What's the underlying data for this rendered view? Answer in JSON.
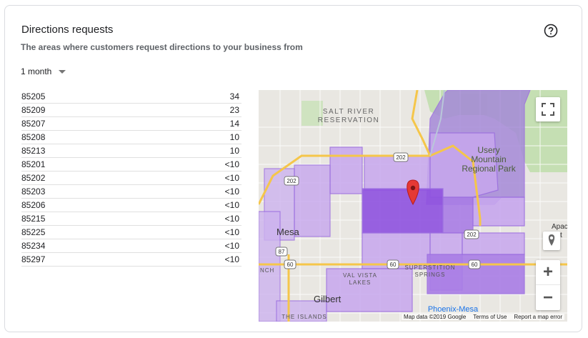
{
  "header": {
    "title": "Directions requests",
    "subtitle": "The areas where customers request directions to your business from"
  },
  "period": {
    "selected": "1 month"
  },
  "table": {
    "rows": [
      {
        "zip": "85205",
        "count": "34"
      },
      {
        "zip": "85209",
        "count": "23"
      },
      {
        "zip": "85207",
        "count": "14"
      },
      {
        "zip": "85208",
        "count": "10"
      },
      {
        "zip": "85213",
        "count": "10"
      },
      {
        "zip": "85201",
        "count": "<10"
      },
      {
        "zip": "85202",
        "count": "<10"
      },
      {
        "zip": "85203",
        "count": "<10"
      },
      {
        "zip": "85206",
        "count": "<10"
      },
      {
        "zip": "85215",
        "count": "<10"
      },
      {
        "zip": "85225",
        "count": "<10"
      },
      {
        "zip": "85234",
        "count": "<10"
      },
      {
        "zip": "85297",
        "count": "<10"
      }
    ]
  },
  "map": {
    "labels": {
      "reservation_1": "SALT RIVER",
      "reservation_2": "RESERVATION",
      "park_1": "Usery",
      "park_2": "Mountain",
      "park_3": "Regional Park",
      "mesa": "Mesa",
      "gilbert": "Gilbert",
      "superstition_1": "SUPERSTITION",
      "superstition_2": "SPRINGS",
      "valvista_1": "VAL VISTA",
      "valvista_2": "LAKES",
      "phoenix_mesa": "Phoenix-Mesa",
      "islands": "THE ISLANDS",
      "apache_1": "Apache",
      "apache_2": "Jct",
      "ranch": "NCH",
      "hwy_202_a": "202",
      "hwy_202_b": "202",
      "hwy_202_c": "202",
      "hwy_87": "87",
      "hwy_60_a": "60",
      "hwy_60_b": "60",
      "hwy_60_c": "60"
    },
    "attribution": {
      "data": "Map data ©2019 Google",
      "terms": "Terms of Use",
      "report": "Report a map error"
    },
    "zoom_in": "+",
    "zoom_out": "−"
  },
  "colors": {
    "region_light": "#c7a7ee",
    "region_mid": "#a97de6",
    "region_dark": "#8f52e0",
    "park_green": "#c5dfb3",
    "pin_red": "#e53935"
  }
}
